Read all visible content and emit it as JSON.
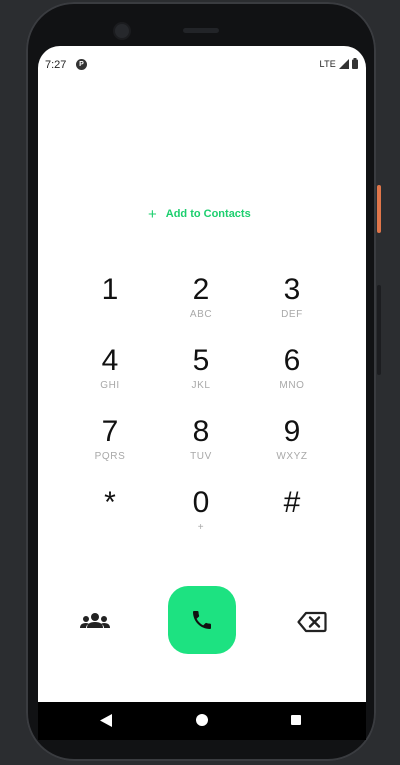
{
  "status_bar": {
    "time": "7:27",
    "app_icon": "P",
    "network": "LTE"
  },
  "add_contacts": {
    "icon": "+",
    "label": "Add to Contacts"
  },
  "keypad": [
    {
      "digit": "1",
      "letters": ""
    },
    {
      "digit": "2",
      "letters": "ABC"
    },
    {
      "digit": "3",
      "letters": "DEF"
    },
    {
      "digit": "4",
      "letters": "GHI"
    },
    {
      "digit": "5",
      "letters": "JKL"
    },
    {
      "digit": "6",
      "letters": "MNO"
    },
    {
      "digit": "7",
      "letters": "PQRS"
    },
    {
      "digit": "8",
      "letters": "TUV"
    },
    {
      "digit": "9",
      "letters": "WXYZ"
    },
    {
      "digit": "*",
      "letters": ""
    },
    {
      "digit": "0",
      "letters": "+"
    },
    {
      "digit": "#",
      "letters": ""
    }
  ],
  "actions": {
    "contacts_icon": "group-icon",
    "call_icon": "phone-icon",
    "delete_icon": "backspace-icon"
  },
  "colors": {
    "accent": "#1de281",
    "accent_text": "#1ccf6e",
    "digit": "#111111",
    "letters": "#a8a8a8",
    "power_button": "#e0764a"
  }
}
